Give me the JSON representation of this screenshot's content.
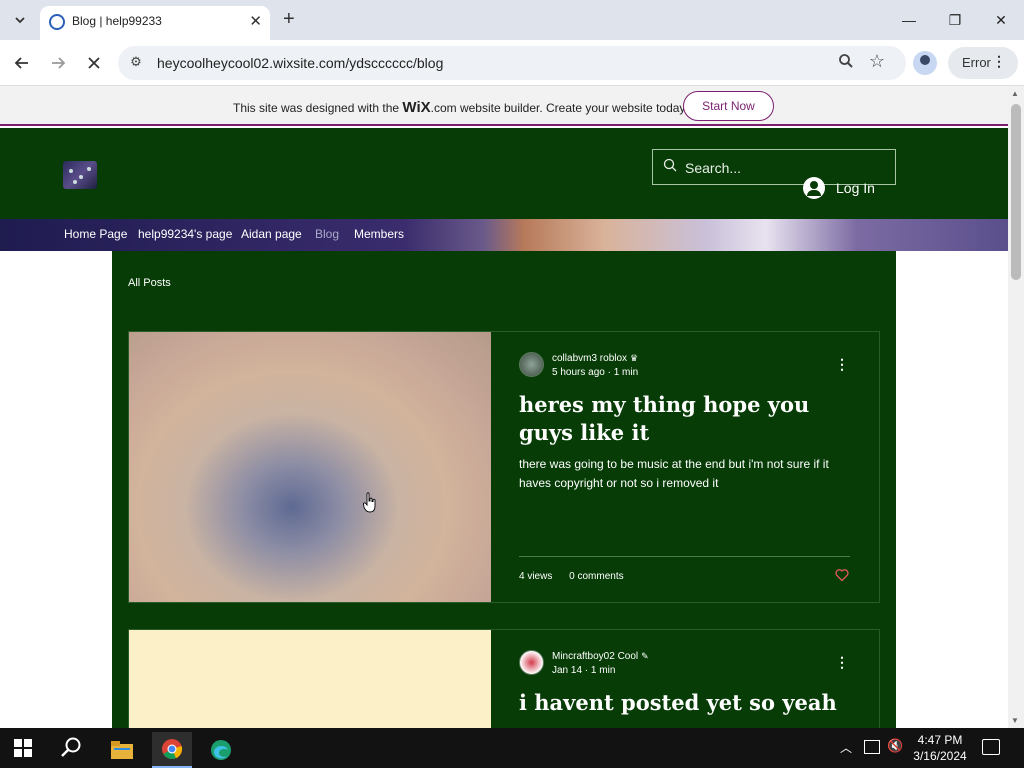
{
  "browser": {
    "tab_title": "Blog | help99233",
    "url": "heycoolheycool02.wixsite.com/ydscccccc/blog",
    "profile_status": "Error"
  },
  "wix_banner": {
    "text_before": "This site was designed with the ",
    "logo": "WiX",
    "text_after": ".com website builder. Create your website today.",
    "cta": "Start Now"
  },
  "site": {
    "search_placeholder": "Search...",
    "login_label": "Log In",
    "nav": [
      "Home Page",
      "help99234's page",
      "Aidan page",
      "Blog",
      "Members"
    ],
    "active_nav": "Blog"
  },
  "blog": {
    "filter_label": "All Posts",
    "posts": [
      {
        "author": "collabvm3 roblox",
        "author_badge": "crown-icon",
        "time": "5 hours ago",
        "read_time": "1 min",
        "title": "heres my thing hope you guys like it",
        "excerpt": "there was going to be music at the end but i'm not sure if it haves copyright or not so i removed it",
        "views": "4 views",
        "comments": "0 comments"
      },
      {
        "author": "Mincraftboy02 Cool",
        "author_badge": "pen-icon",
        "time": "Jan 14",
        "read_time": "1 min",
        "title": "i havent posted yet so yeah"
      }
    ]
  },
  "taskbar": {
    "time": "4:47 PM",
    "date": "3/16/2024"
  },
  "colors": {
    "site_green": "#073c07",
    "wix_accent": "#7a1f6f",
    "like_heart": "#e55a5a"
  }
}
